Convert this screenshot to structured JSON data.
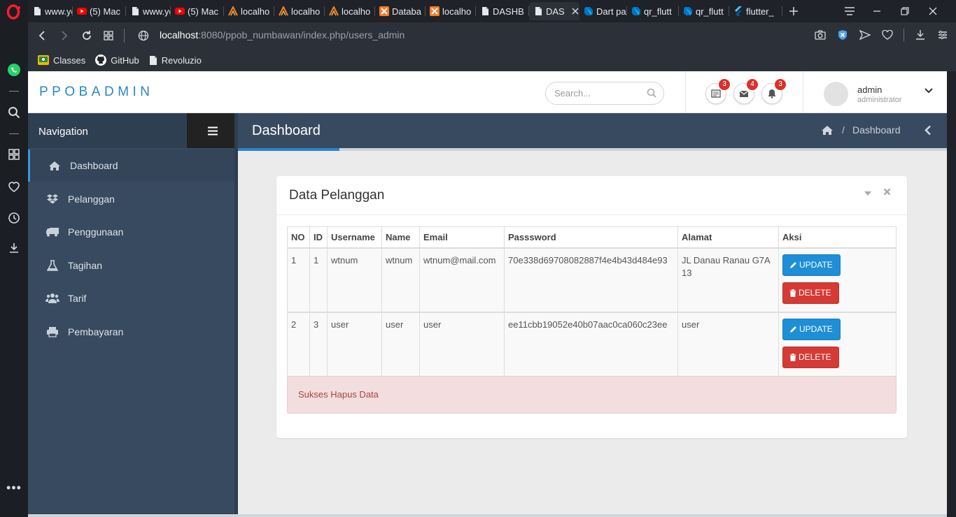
{
  "browser": {
    "tabs": [
      {
        "label": "www.yo",
        "favicon": "file-icon"
      },
      {
        "label": "(5) Mac",
        "favicon": "youtube-icon"
      },
      {
        "label": "www.yo",
        "favicon": "file-icon"
      },
      {
        "label": "(5) Mac",
        "favicon": "youtube-icon"
      },
      {
        "label": "localho",
        "favicon": "xampp-icon"
      },
      {
        "label": "localho",
        "favicon": "xampp-icon"
      },
      {
        "label": "localho",
        "favicon": "xampp-icon"
      },
      {
        "label": "Databa",
        "favicon": "xampp-orange-icon"
      },
      {
        "label": "localho",
        "favicon": "xampp-orange-icon"
      },
      {
        "label": "DASHB",
        "favicon": "file-icon"
      },
      {
        "label": "DAS",
        "favicon": "file-icon",
        "active": true
      },
      {
        "label": "Dart pa",
        "favicon": "dart-icon"
      },
      {
        "label": "qr_flutt",
        "favicon": "dart-icon"
      },
      {
        "label": "qr_flutt",
        "favicon": "dart-icon"
      },
      {
        "label": "flutter_",
        "favicon": "flutter-icon"
      }
    ],
    "url_host": "localhost",
    "url_rest": ":8080/ppob_numbawan/index.php/users_admin",
    "bookmarks": [
      {
        "label": "Classes",
        "icon": "classes-icon"
      },
      {
        "label": "GitHub",
        "icon": "github-icon"
      },
      {
        "label": "Revoluzio",
        "icon": "file-icon"
      }
    ]
  },
  "app": {
    "brand": "PPOBADMIN",
    "search_placeholder": "Search...",
    "notifications": [
      {
        "icon": "list-icon",
        "count": "3"
      },
      {
        "icon": "envelope-icon",
        "count": "4"
      },
      {
        "icon": "bell-icon",
        "count": "3"
      }
    ],
    "user": {
      "name": "admin",
      "role": "administrator"
    },
    "sidebar": {
      "title": "Navigation",
      "items": [
        {
          "label": "Dashboard",
          "icon": "home-icon",
          "active": true
        },
        {
          "label": "Pelanggan",
          "icon": "dropbox-icon"
        },
        {
          "label": "Penggunaan",
          "icon": "truck-icon"
        },
        {
          "label": "Tagihan",
          "icon": "flask-icon"
        },
        {
          "label": "Tarif",
          "icon": "users-icon"
        },
        {
          "label": "Pembayaran",
          "icon": "print-icon"
        }
      ]
    },
    "page_title": "Dashboard",
    "breadcrumb": "Dashboard",
    "panel": {
      "title": "Data Pelanggan",
      "columns": [
        "NO",
        "ID",
        "Username",
        "Name",
        "Email",
        "Passsword",
        "Alamat",
        "Aksi"
      ],
      "rows": [
        {
          "no": "1",
          "id": "1",
          "username": "wtnum",
          "name": "wtnum",
          "email": "wtnum@mail.com",
          "password": "70e338d69708082887f4e4b43d484e93",
          "alamat": "JL Danau Ranau G7A 13"
        },
        {
          "no": "2",
          "id": "3",
          "username": "user",
          "name": "user",
          "email": "user",
          "password": "ee11cbb19052e40b07aac0ca060c23ee",
          "alamat": "user"
        }
      ],
      "update_label": "UPDATE",
      "delete_label": "DELETE",
      "alert": "Sukses Hapus Data"
    }
  },
  "colors": {
    "brand": "#2a86c9",
    "sidebar": "#384a5f",
    "update": "#1e8ed6",
    "delete": "#d53a35",
    "alert_bg": "#f2dede",
    "alert_text": "#a94442"
  }
}
